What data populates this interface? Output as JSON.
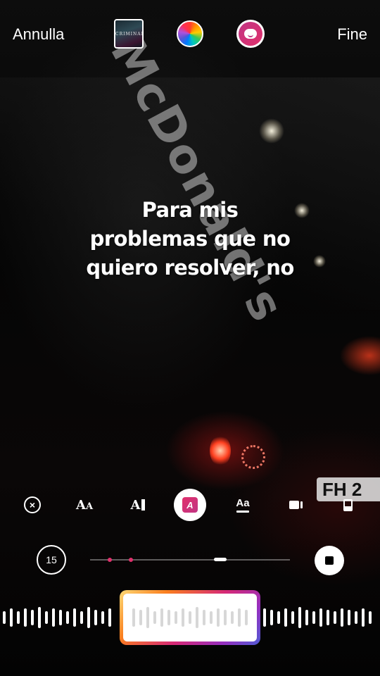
{
  "top_bar": {
    "cancel_label": "Annulla",
    "done_label": "Fine",
    "album_cover_text": "CRIMINAL",
    "color_wheel_icon": "color-wheel-icon",
    "sticker_icon": "sticker-icon"
  },
  "lyrics": {
    "lines": [
      "Para mis",
      "problemas que no",
      "quiero resolver, no"
    ]
  },
  "style_toolbar": {
    "tools": [
      {
        "name": "remove-lyrics",
        "icon": "close-circle-icon",
        "label": "⊗",
        "active": false
      },
      {
        "name": "font-size",
        "icon": "text-size-icon",
        "label": "AA",
        "active": false
      },
      {
        "name": "text-align",
        "icon": "text-cursor-icon",
        "label": "A",
        "active": false
      },
      {
        "name": "text-effect",
        "icon": "highlight-text-icon",
        "label": "A",
        "active": true
      },
      {
        "name": "typewriter",
        "icon": "underline-text-icon",
        "label": "Aa",
        "active": false
      },
      {
        "name": "video-layout",
        "icon": "video-icon",
        "label": "",
        "active": false
      },
      {
        "name": "card-layout",
        "icon": "card-icon",
        "label": "",
        "active": false
      }
    ]
  },
  "playback": {
    "duration": "15",
    "stop_icon": "stop-icon",
    "progress": 0.65
  },
  "colors": {
    "accent_pink": "#e1306c",
    "gradient": [
      "#feda75",
      "#fa7e1e",
      "#d62976",
      "#962fbf",
      "#4f5bd5"
    ]
  },
  "background": {
    "sign_text": "McDonald's",
    "plate_text": "FH 2"
  }
}
